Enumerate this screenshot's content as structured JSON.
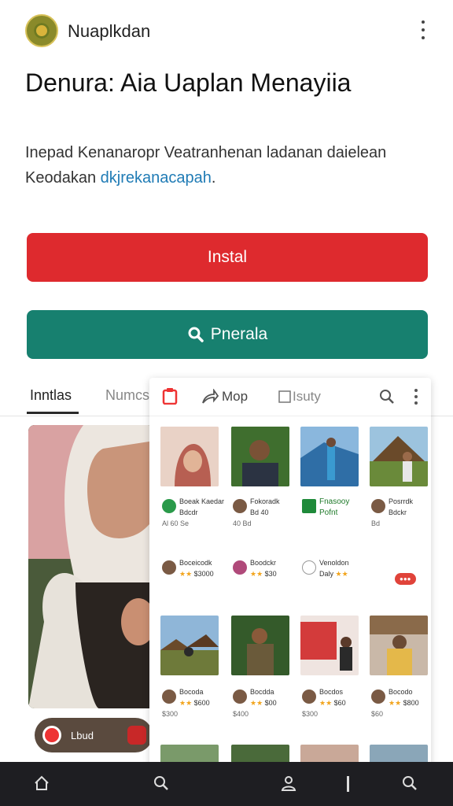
{
  "header": {
    "app_name": "Nuaplkdan"
  },
  "title": "Denura: Aia Uaplan Menayiia",
  "description": {
    "text": "Inepad Kenanaropr Veatranhenan ladanan daielean Keodakan ",
    "link": "dkjrekanacapah",
    "end": "."
  },
  "buttons": {
    "install": "Instal",
    "preview": "Pnerala"
  },
  "tabs": [
    {
      "label": "Inntlas",
      "active": true
    },
    {
      "label": "Numcs",
      "active": false
    }
  ],
  "left_card": {
    "pill_label": "Lbud"
  },
  "panel_toolbar": {
    "map_label": "Mop",
    "study_label": "Isuty"
  },
  "grid_rows": [
    {
      "cells": [
        {
          "l1": "Boeak Kaedar",
          "l2": "Bdcdr",
          "l3": "Al 60 Se"
        },
        {
          "l1": "Fokoradk",
          "l2": "Bd 40",
          "l3": "40 Bd"
        },
        {
          "l1": "Fnasooy",
          "l2": "Pofnt",
          "l3": ""
        },
        {
          "l1": "Posrrdk",
          "l2": "Bdckr",
          "l3": "Bd"
        }
      ]
    },
    {
      "cells": [
        {
          "l1": "Boceicodk",
          "l2": "$3000",
          "l3": ""
        },
        {
          "l1": "Boodckr",
          "l2": "$30",
          "l3": ""
        },
        {
          "l1": "Venoldon",
          "l2": "Daly",
          "l3": ""
        },
        {
          "l1": "",
          "l2": "",
          "l3": ""
        }
      ]
    },
    {
      "cells": [
        {
          "l1": "Bocoda",
          "l2": "$600",
          "l3": "$300"
        },
        {
          "l1": "Bocdda",
          "l2": "$00",
          "l3": "$400"
        },
        {
          "l1": "Bocdos",
          "l2": "$60",
          "l3": "$300"
        },
        {
          "l1": "Bocodo",
          "l2": "$800",
          "l3": "$60"
        }
      ]
    }
  ],
  "nav": [
    "home-icon",
    "search-icon",
    "profile-icon",
    "divider",
    "search-icon"
  ],
  "colors": {
    "install": "#de2a2e",
    "preview": "#17806f",
    "nav": "#1e1e22"
  }
}
